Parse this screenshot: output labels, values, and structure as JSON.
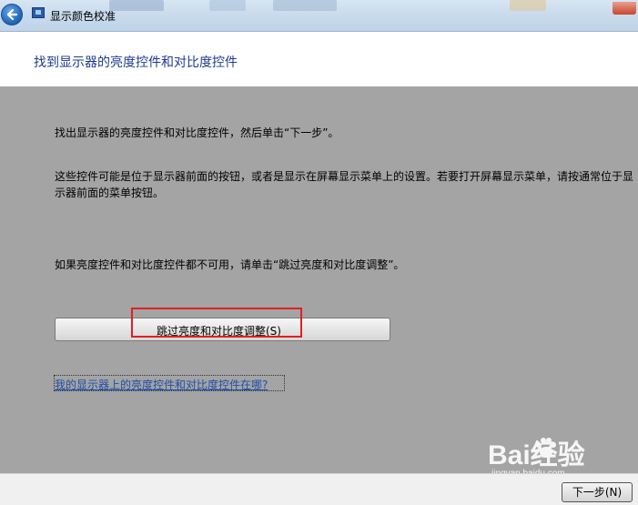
{
  "window": {
    "title": "显示颜色校准",
    "colors": {
      "accent_title": "#1e3a8f",
      "content_bg": "#a4a4a4",
      "highlight": "#e02020",
      "link": "#1f4fa8"
    }
  },
  "icons": [
    "back-arrow-icon",
    "display-calibration-icon",
    "close-icon"
  ],
  "header": {
    "title": "找到显示器的亮度控件和对比度控件"
  },
  "content": {
    "instruction": "找出显示器的亮度控件和对比度控件，然后单击“下一步”。",
    "description": "这些控件可能是位于显示器前面的按钮，或者是显示在屏幕显示菜单上的设置。若要打开屏幕显示菜单，请按通常位于显示器前面的菜单按钮。",
    "unavailable_note": "如果亮度控件和对比度控件都不可用，请单击“跳过亮度和对比度调整”。",
    "skip_button_label": "跳过亮度和对比度调整(S)",
    "help_link": "我的显示器上的亮度控件和对比度控件在哪?"
  },
  "watermark": {
    "brand": "Bai经验",
    "sub": "jingyan.baidu.com"
  },
  "footer": {
    "next_button_label": "下一步(N)"
  }
}
